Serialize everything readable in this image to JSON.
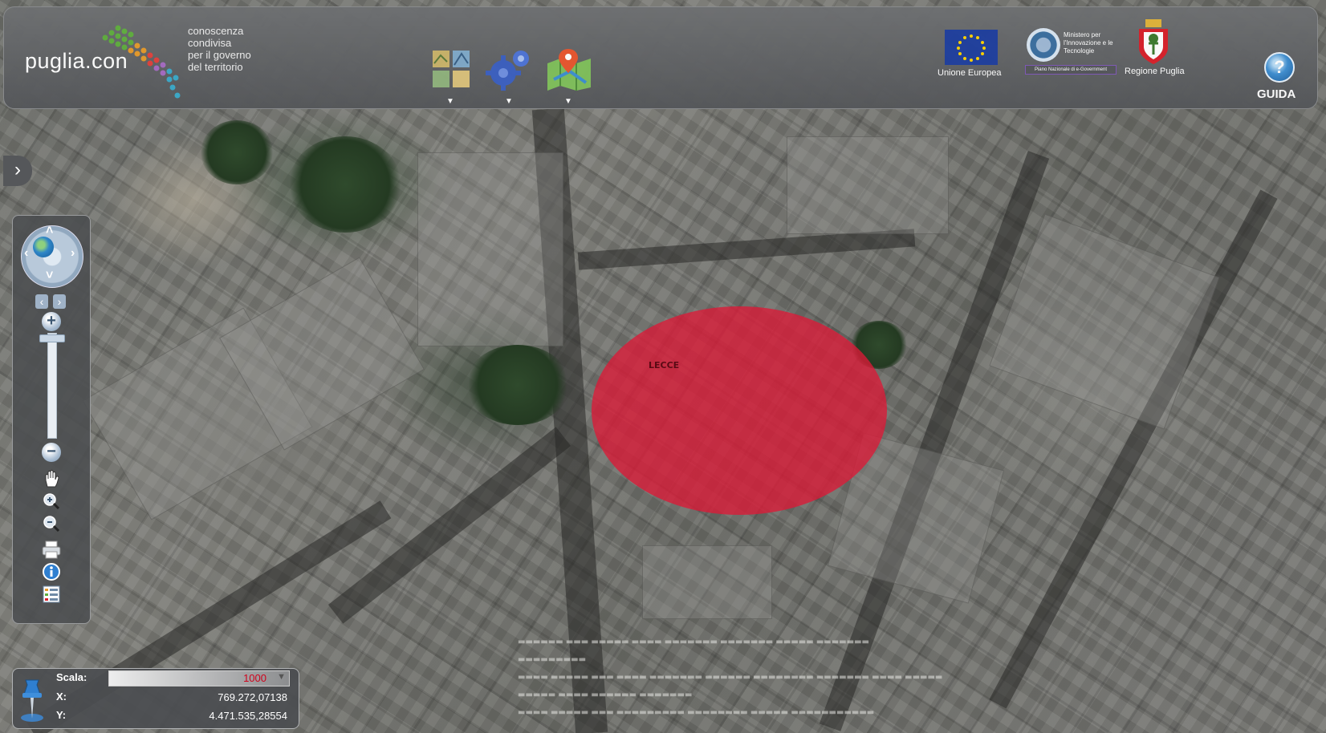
{
  "header": {
    "logo_text": "puglia.con",
    "tagline": [
      "conoscenza",
      "condivisa",
      "per il governo",
      "del territorio"
    ],
    "tools": [
      {
        "icon": "layers-grid-icon",
        "caret": "▼"
      },
      {
        "icon": "gears-icon",
        "caret": "▼"
      },
      {
        "icon": "map-pin-icon",
        "caret": "▼"
      }
    ],
    "eu_label": "Unione Europea",
    "ministry_text": "Ministero per l'Innovazione e le Tecnologie",
    "ministry_sub": "Piano Nazionale di e-Government",
    "region_label": "Regione Puglia",
    "help_symbol": "?",
    "help_label": "GUIDA"
  },
  "nav": {
    "expand_symbol": "›",
    "pan_arrows": {
      "up": "˄",
      "down": "˅",
      "left": "‹",
      "right": "›"
    },
    "prev_symbol": "‹",
    "next_symbol": "›",
    "zoom_in": "+",
    "zoom_out": "−",
    "tools": [
      "pan-hand-icon",
      "zoom-in-box-icon",
      "zoom-out-box-icon",
      "print-icon",
      "info-icon",
      "legend-icon"
    ]
  },
  "map": {
    "feature_label": "LECCE",
    "feature_color": "#dc1937"
  },
  "coords": {
    "scale_label": "Scala:",
    "scale_value": "1000",
    "scale_caret": "▼",
    "x_label": "X:",
    "x_value": "769.272,07138",
    "y_label": "Y:",
    "y_value": "4.471.535,28554"
  }
}
